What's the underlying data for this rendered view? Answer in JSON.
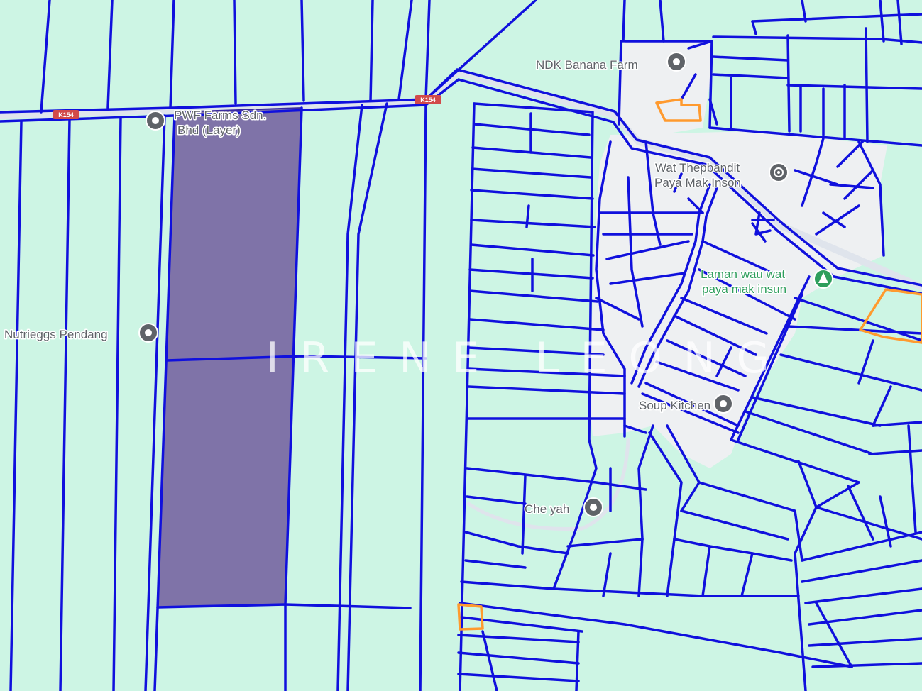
{
  "map": {
    "colors": {
      "land": "#cdf5e4",
      "village": "#eef0f2",
      "road": "#dfe4ec",
      "lot_boundary": "#1010dd",
      "selected_lot": "#7f73a8",
      "highlight": "#ff9a2e",
      "poi": "#5f6368",
      "park_poi": "#2e9e5c"
    },
    "road_shields": [
      {
        "label": "K154"
      },
      {
        "label": "K154"
      }
    ],
    "places": [
      {
        "name": "NDK Banana Farm",
        "icon": "pin-icon"
      },
      {
        "name": "PWF Farms Sdn. Bhd (Layer)",
        "line1": "PWF Farms Sdn.",
        "line2": "Bhd (Layer)",
        "icon": "pin-icon"
      },
      {
        "name": "Wat Thepbandit Paya Mak Inson",
        "line1": "Wat Thepbandit",
        "line2": "Paya Mak Inson",
        "icon": "temple-icon"
      },
      {
        "name": "Laman wau wat paya mak insun",
        "line1": "Laman wau wat",
        "line2": "paya mak insun",
        "icon": "park-icon"
      },
      {
        "name": "Nutrieggs Pendang",
        "icon": "pin-icon"
      },
      {
        "name": "Soup Kitchen",
        "icon": "pin-icon"
      },
      {
        "name": "Che yah",
        "icon": "pin-icon"
      }
    ],
    "watermark": "IRENE LEONG"
  }
}
